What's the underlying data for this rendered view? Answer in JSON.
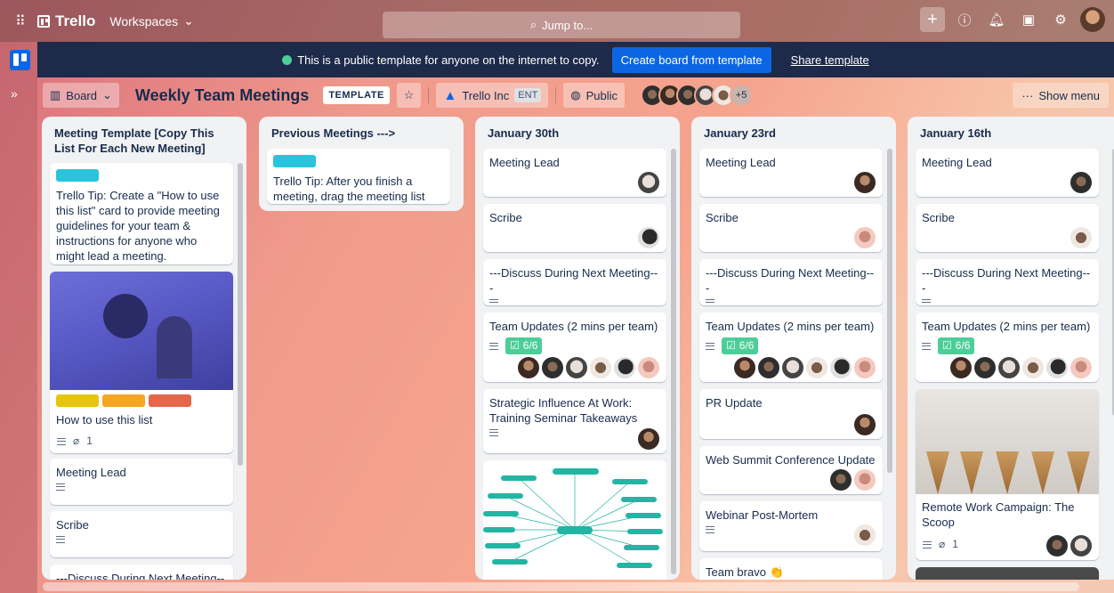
{
  "topbar": {
    "app_name": "Trello",
    "workspaces": "Workspaces",
    "search_placeholder": "Jump to..."
  },
  "banner": {
    "message": "This is a public template for anyone on the internet to copy.",
    "create_button": "Create board from template",
    "share_link": "Share template"
  },
  "boardbar": {
    "view": "Board",
    "title": "Weekly Team Meetings",
    "template_badge": "TEMPLATE",
    "workspace": "Trello Inc",
    "workspace_tag": "ENT",
    "visibility": "Public",
    "extra_members": "+5",
    "show_menu": "Show menu"
  },
  "lists": [
    {
      "title": "Meeting Template [Copy This List For Each New Meeting]",
      "cards": [
        {
          "text": "Trello Tip: Create a \"How to use this list\" card to provide meeting guidelines for your team & instructions for anyone who might lead a meeting."
        },
        {
          "text": "How to use this list",
          "attachments": "1"
        },
        {
          "text": "Meeting Lead"
        },
        {
          "text": "Scribe"
        },
        {
          "text": "---Discuss During Next Meeting---"
        }
      ]
    },
    {
      "title": "Previous Meetings --->",
      "cards": [
        {
          "text": "Trello Tip: After you finish a meeting, drag the meeting list here. ->"
        }
      ]
    },
    {
      "title": "January 30th",
      "cards": [
        {
          "text": "Meeting Lead"
        },
        {
          "text": "Scribe"
        },
        {
          "text": "---Discuss During Next Meeting---"
        },
        {
          "text": "Team Updates (2 mins per team)",
          "checklist": "6/6"
        },
        {
          "text": "Strategic Influence At Work: Training Seminar Takeaways"
        }
      ]
    },
    {
      "title": "January 23rd",
      "cards": [
        {
          "text": "Meeting Lead"
        },
        {
          "text": "Scribe"
        },
        {
          "text": "---Discuss During Next Meeting---"
        },
        {
          "text": "Team Updates (2 mins per team)",
          "checklist": "6/6"
        },
        {
          "text": "PR Update"
        },
        {
          "text": "Web Summit Conference Update"
        },
        {
          "text": "Webinar Post-Mortem"
        },
        {
          "text": "Team bravo 👏"
        }
      ]
    },
    {
      "title": "January 16th",
      "cards": [
        {
          "text": "Meeting Lead"
        },
        {
          "text": "Scribe"
        },
        {
          "text": "---Discuss During Next Meeting---"
        },
        {
          "text": "Team Updates (2 mins per team)",
          "checklist": "6/6"
        },
        {
          "text": "Remote Work Campaign: The Scoop",
          "attachments": "1"
        }
      ]
    }
  ],
  "colors": {
    "banner_bg": "#1d2a49",
    "primary": "#0c66e4",
    "label_cyan": "#29c5dc",
    "label_yellow": "#e6c60d",
    "label_orange": "#f5a623",
    "label_red": "#e5674b",
    "checklist_green": "#4bce97"
  }
}
